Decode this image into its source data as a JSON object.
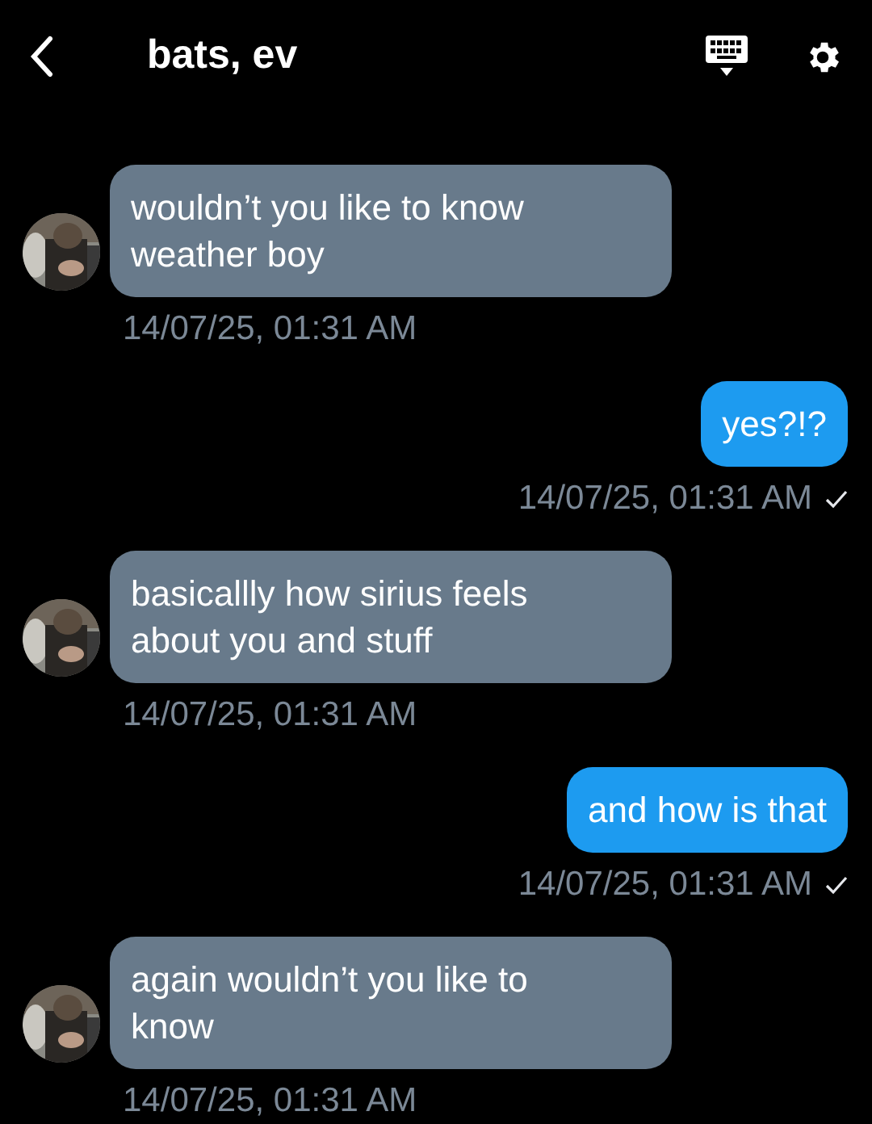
{
  "header": {
    "title": "bats, ev"
  },
  "messages": [
    {
      "kind": "incoming",
      "text": "wouldn’t you like to know weather boy",
      "time": "14/07/25, 01:31 AM"
    },
    {
      "kind": "outgoing",
      "text": "yes?!?",
      "time": "14/07/25, 01:31 AM",
      "read": true
    },
    {
      "kind": "incoming",
      "text": "basicallly how sirius feels about you and stuff",
      "time": "14/07/25, 01:31 AM"
    },
    {
      "kind": "outgoing",
      "text": "and how is that",
      "time": "14/07/25, 01:31 AM",
      "read": true
    },
    {
      "kind": "incoming",
      "text": "again wouldn’t you like to know",
      "time": "14/07/25, 01:31 AM"
    }
  ]
}
